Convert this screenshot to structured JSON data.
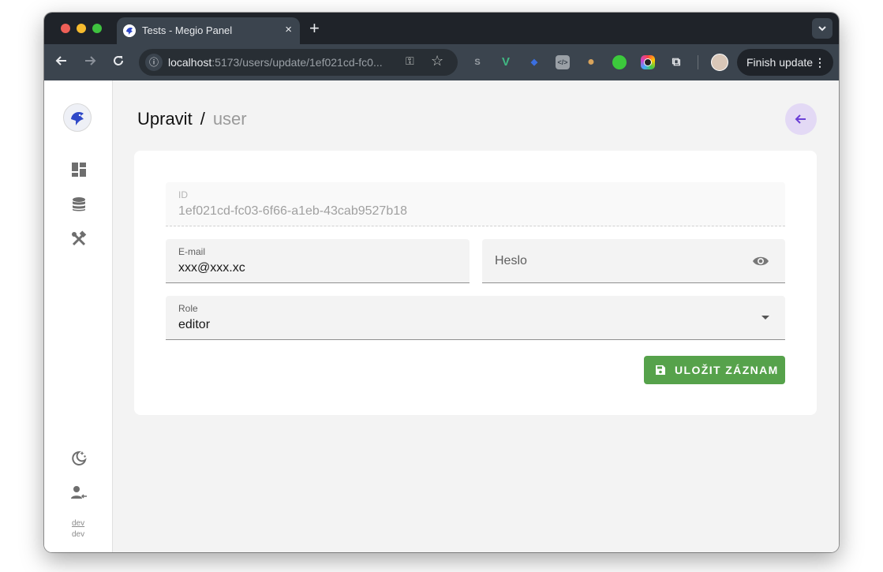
{
  "browser": {
    "tab_title": "Tests - Megio Panel",
    "tab_close": "×",
    "new_tab": "+",
    "tab_menu": "⌄",
    "url_host": "localhost",
    "url_rest": ":5173/users/update/1ef021cd-fc0...",
    "finish_update": "Finish update",
    "menu_dots": "⋮",
    "extensions": [
      {
        "name": "svelte",
        "glyph": "S",
        "color": "#9aa0a6"
      },
      {
        "name": "vue",
        "glyph": "V",
        "color": "#41b883"
      },
      {
        "name": "tag",
        "glyph": "◆",
        "color": "#3b6fe0"
      },
      {
        "name": "code",
        "glyph": "</>",
        "color": "#9aa0a6"
      },
      {
        "name": "cookie",
        "glyph": "●",
        "color": "#d9a45b"
      },
      {
        "name": "thumbs-up",
        "glyph": "👍",
        "color": "#3cc93c"
      },
      {
        "name": "color-picker",
        "glyph": "◉",
        "color": "#c44cd6"
      },
      {
        "name": "extensions-puzzle",
        "glyph": "⧉",
        "color": "#e8eaed"
      }
    ]
  },
  "sidebar": {
    "items": [
      {
        "name": "dashboard"
      },
      {
        "name": "database"
      },
      {
        "name": "tools"
      }
    ],
    "footer_link": "dev",
    "footer_text": "dev"
  },
  "header": {
    "breadcrumb_parent": "Upravit",
    "breadcrumb_separator": "/",
    "breadcrumb_current": "user"
  },
  "form": {
    "id": {
      "label": "ID",
      "value": "1ef021cd-fc03-6f66-a1eb-43cab9527b18"
    },
    "email": {
      "label": "E-mail",
      "value": "xxx@xxx.xc"
    },
    "password": {
      "placeholder": "Heslo"
    },
    "role": {
      "label": "Role",
      "value": "editor"
    },
    "save_label": "ULOŽIT ZÁZNAM"
  },
  "colors": {
    "accent": "#6b3fd6",
    "save": "#56a24b"
  }
}
